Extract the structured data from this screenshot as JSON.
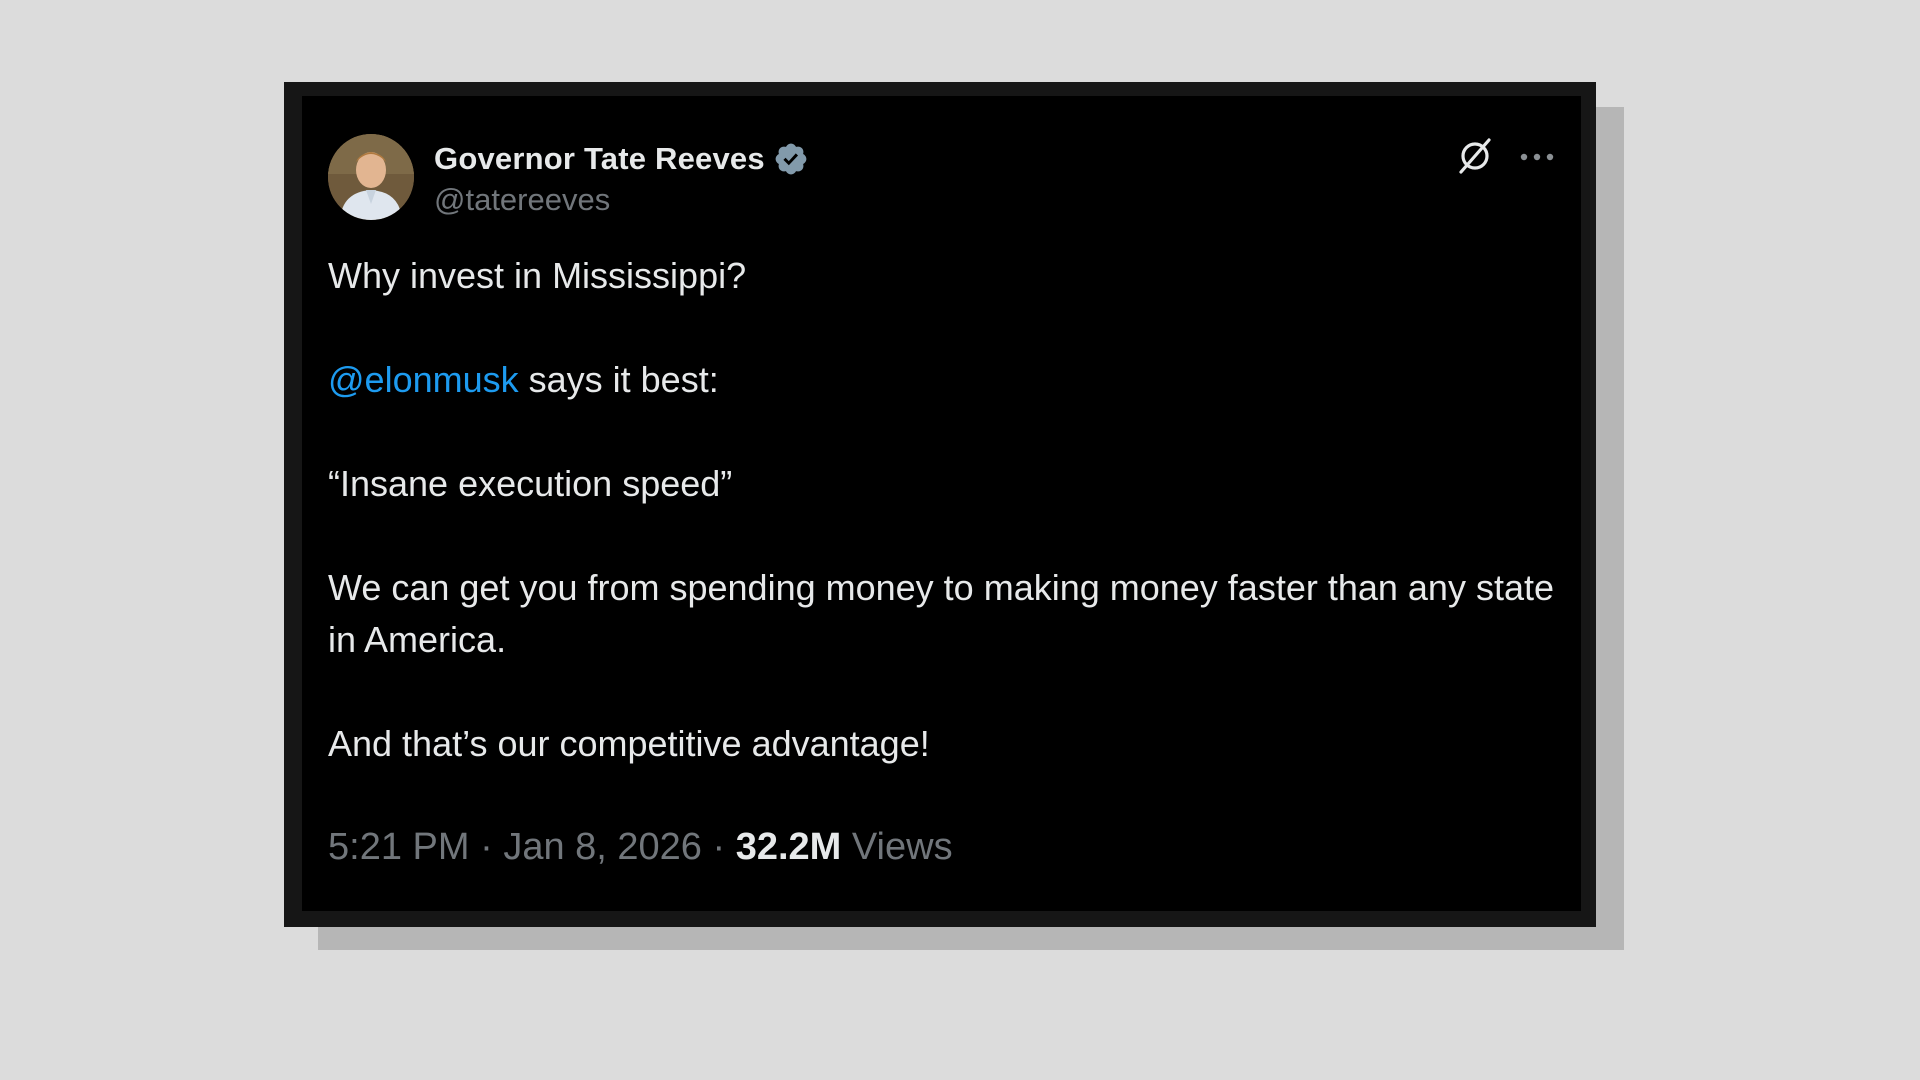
{
  "author": {
    "display_name": "Governor Tate Reeves",
    "handle": "@tatereeves",
    "verified": true
  },
  "icons": {
    "verified": "verified-badge-icon",
    "grok": "grok-icon",
    "more": "more-icon"
  },
  "colors": {
    "background": "#000000",
    "text": "#e7e9ea",
    "muted": "#71767b",
    "mention": "#1d9bf0",
    "verified_badge": "#829aab"
  },
  "tweet": {
    "line1": "Why invest in Mississippi?",
    "mention": "@elonmusk",
    "line2_rest": " says it best:",
    "line3": "“Insane execution speed”",
    "line4": "We can get you from spending money to making money faster than any state in America.",
    "line5": "And that’s our competitive advantage!"
  },
  "meta": {
    "time": "5:21 PM",
    "separator1": " · ",
    "date": "Jan 8, 2026",
    "separator2": " · ",
    "views_count": "32.2M",
    "views_label": " Views"
  }
}
